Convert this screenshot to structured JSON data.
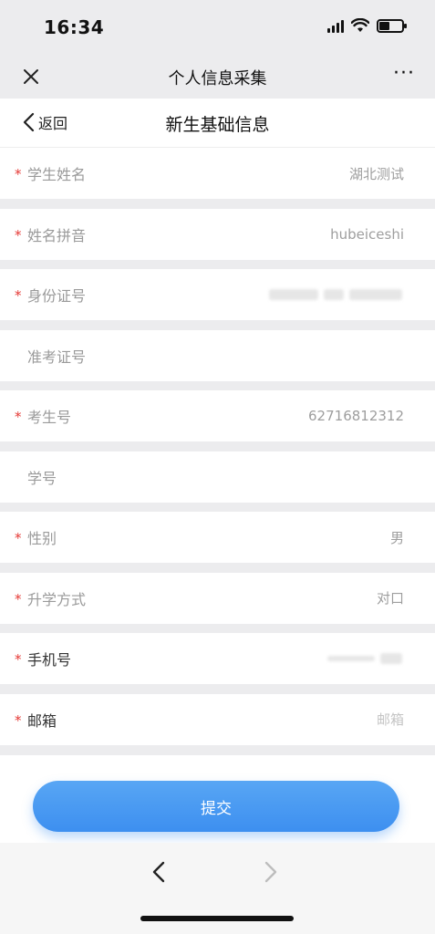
{
  "status_bar": {
    "time": "16:34"
  },
  "nav_bar": {
    "title": "个人信息采集",
    "more_label": "···"
  },
  "page_header": {
    "back_label": "返回",
    "title": "新生基础信息"
  },
  "form": {
    "fields": [
      {
        "label": "学生姓名",
        "required": true,
        "value": "湖北测试"
      },
      {
        "label": "姓名拼音",
        "required": true,
        "value": "hubeiceshi"
      },
      {
        "label": "身份证号",
        "required": true,
        "value": ""
      },
      {
        "label": "准考证号",
        "required": false,
        "value": ""
      },
      {
        "label": "考生号",
        "required": true,
        "value": "62716812312"
      },
      {
        "label": "学号",
        "required": false,
        "value": ""
      },
      {
        "label": "性别",
        "required": true,
        "value": "男"
      },
      {
        "label": "升学方式",
        "required": true,
        "value": "对口"
      },
      {
        "label": "手机号",
        "required": true,
        "value": ""
      },
      {
        "label": "邮箱",
        "required": true,
        "placeholder": "邮箱"
      }
    ],
    "required_mark": "*"
  },
  "submit": {
    "label": "提交"
  },
  "colors": {
    "accent": "#3d8ff0",
    "required": "#e53935"
  }
}
